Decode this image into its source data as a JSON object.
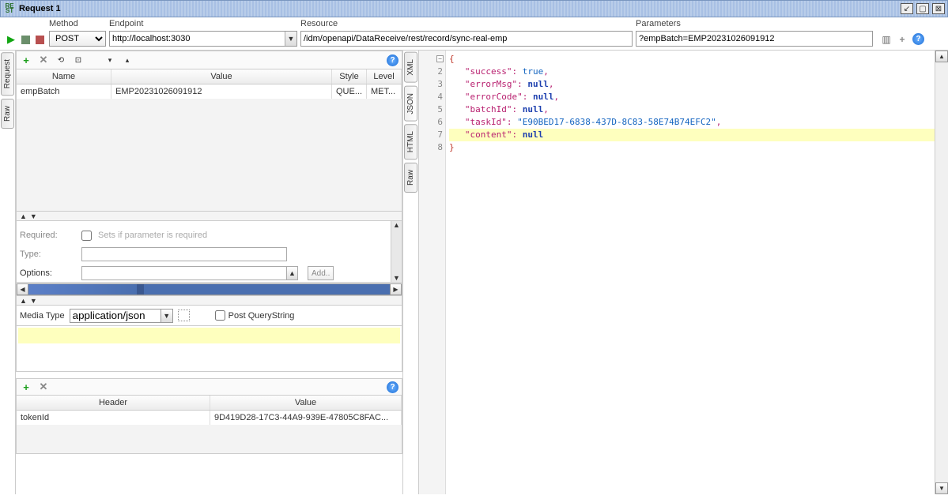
{
  "window": {
    "title": "Request 1"
  },
  "toolbar": {
    "method": {
      "label": "Method",
      "value": "POST"
    },
    "endpoint": {
      "label": "Endpoint",
      "value": "http://localhost:3030"
    },
    "resource": {
      "label": "Resource",
      "value": "/idm/openapi/DataReceive/rest/record/sync-real-emp"
    },
    "parameters": {
      "label": "Parameters",
      "value": "?empBatch=EMP20231026091912"
    }
  },
  "left_tabs": {
    "request": "Request",
    "raw": "Raw"
  },
  "params_table": {
    "headers": {
      "name": "Name",
      "value": "Value",
      "style": "Style",
      "level": "Level"
    },
    "rows": [
      {
        "name": "empBatch",
        "value": "EMP20231026091912",
        "style": "QUE...",
        "level": "MET..."
      }
    ]
  },
  "prop_form": {
    "required_label": "Required:",
    "required_desc": "Sets if parameter is required",
    "type_label": "Type:",
    "options_label": "Options:",
    "add_label": "Add.."
  },
  "media": {
    "label": "Media Type",
    "value": "application/json",
    "post_qs_label": "Post QueryString"
  },
  "headers_table": {
    "headers": {
      "name": "Header",
      "value": "Value"
    },
    "rows": [
      {
        "name": "tokenId",
        "value": "9D419D28-17C3-44A9-939E-47805C8FAC..."
      }
    ]
  },
  "response_tabs": {
    "xml": "XML",
    "json": "JSON",
    "html": "HTML",
    "raw": "Raw"
  },
  "response_json": {
    "success_key": "\"success\"",
    "success_val": "true",
    "errorMsg_key": "\"errorMsg\"",
    "errorMsg_val": "null",
    "errorCode_key": "\"errorCode\"",
    "errorCode_val": "null",
    "batchId_key": "\"batchId\"",
    "batchId_val": "null",
    "taskId_key": "\"taskId\"",
    "taskId_val": "\"E90BED17-6838-437D-8C83-58E74B74EFC2\"",
    "content_key": "\"content\"",
    "content_val": "null"
  }
}
